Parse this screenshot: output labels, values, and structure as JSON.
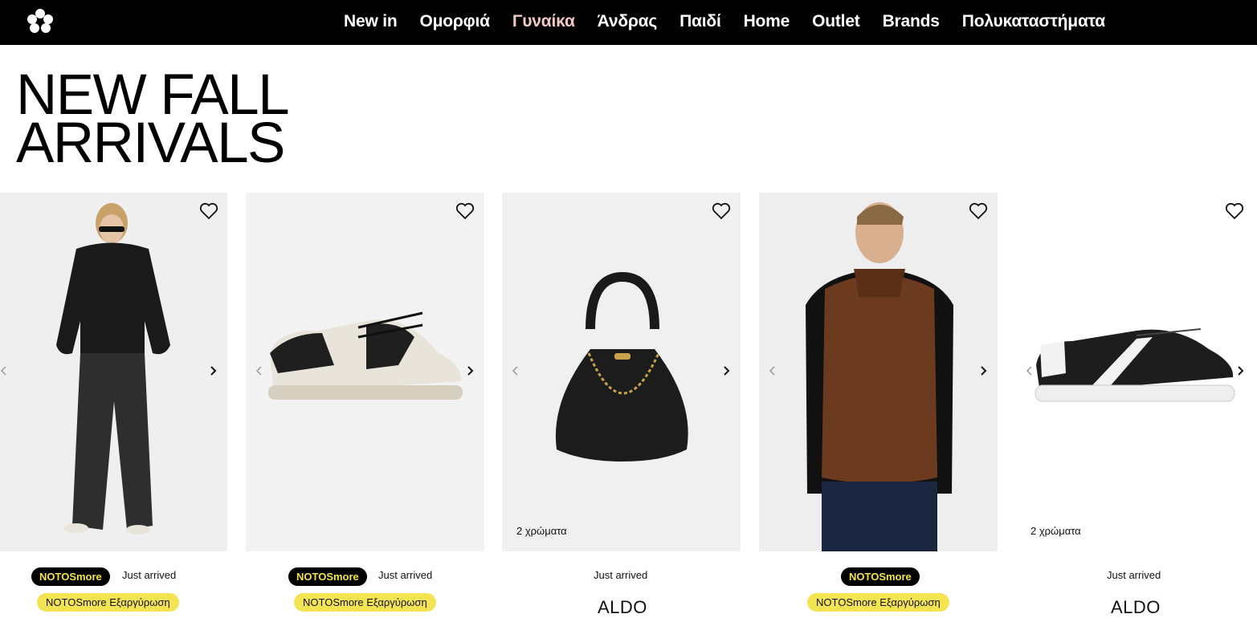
{
  "header": {
    "logo_icon": "flower-dots-icon",
    "nav": [
      "New in",
      "Ομορφιά",
      "Γυναίκα",
      "Άνδρας",
      "Παιδί",
      "Home",
      "Outlet",
      "Brands",
      "Πολυκαταστήματα"
    ],
    "active_nav": "Γυναίκα",
    "active_color": "#f2c8c3"
  },
  "hero": {
    "line1": "NEW FALL",
    "line2": "ARRIVALS"
  },
  "products": [
    {
      "image": "woman-black-puffer-jacket",
      "colors_label": "",
      "badge": "NOTOSmore",
      "status": "Just arrived",
      "promo": "NOTOSmore Εξαργύρωση",
      "brand": ""
    },
    {
      "image": "beige-black-sneaker",
      "colors_label": "",
      "badge": "NOTOSmore",
      "status": "Just arrived",
      "promo": "NOTOSmore Εξαργύρωση",
      "brand": ""
    },
    {
      "image": "black-bucket-bag-gold-chain",
      "colors_label": "2 χρώματα",
      "badge": "",
      "status": "Just arrived",
      "promo": "",
      "brand": "ALDO"
    },
    {
      "image": "man-brown-leather-puffer-vest",
      "colors_label": "",
      "badge": "NOTOSmore",
      "status": "",
      "promo": "NOTOSmore Εξαργύρωση",
      "brand": ""
    },
    {
      "image": "black-white-stripe-sneaker",
      "colors_label": "2 χρώματα",
      "badge": "",
      "status": "Just arrived",
      "promo": "",
      "brand": "ALDO"
    }
  ],
  "icons": {
    "favorite": "heart-outline-icon",
    "prev": "chevron-left-icon",
    "next": "chevron-right-icon"
  },
  "colors": {
    "topbar": "#000000",
    "badge_text": "#f3e24b",
    "promo_bg": "#f4e452"
  }
}
